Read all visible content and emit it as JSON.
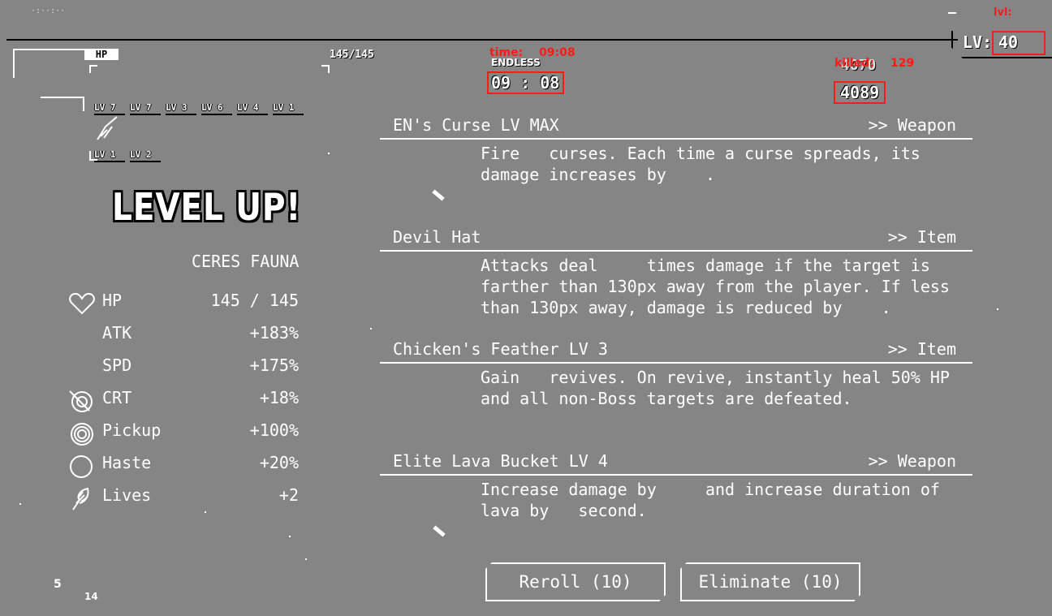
{
  "hud": {
    "hp_label": "HP",
    "hp_count": "145/145",
    "timer_mode": "ENDLESS",
    "timer": "09 : 08",
    "kill_count": "4089",
    "kill_count_prev": "4070",
    "level_label": "LV:",
    "level_value": "40",
    "corner_text": "·:··:··",
    "bottom_left_a": "5",
    "bottom_left_b": "14"
  },
  "debug": {
    "lvl_tag": "lvl:",
    "time_tag": "time:",
    "time_value": "09:08",
    "killed_tag": "killed:",
    "killed_value": "129"
  },
  "weapon_levels": [
    "LV 7",
    "LV 7",
    "LV 3",
    "LV 6",
    "LV 4",
    "LV 1"
  ],
  "item_levels": [
    "LV 1",
    "LV 2"
  ],
  "level_up": {
    "title": "LEVEL UP!",
    "character": "CERES FAUNA"
  },
  "stats": [
    {
      "icon": "heart-icon",
      "label": "HP",
      "value": "145 / 145"
    },
    {
      "icon": "",
      "label": "ATK",
      "value": "+183%"
    },
    {
      "icon": "",
      "label": "SPD",
      "value": "+175%"
    },
    {
      "icon": "crit-target-icon",
      "label": "CRT",
      "value": "+18%"
    },
    {
      "icon": "pickup-rings-icon",
      "label": "Pickup",
      "value": "+100%"
    },
    {
      "icon": "haste-circle-icon",
      "label": "Haste",
      "value": "+20%"
    },
    {
      "icon": "feather-icon",
      "label": "Lives",
      "value": "+2"
    }
  ],
  "upgrades": [
    {
      "title": "EN's Curse LV MAX",
      "type": ">> Weapon",
      "desc": "Fire   curses. Each time a curse spreads, its\ndamage increases by    ."
    },
    {
      "title": "Devil Hat",
      "type": ">> Item",
      "desc": "Attacks deal     times damage if the target is\nfarther than 130px away from the player. If less\nthan 130px away, damage is reduced by    ."
    },
    {
      "title": "Chicken's Feather LV 3",
      "type": ">> Item",
      "desc": "Gain   revives. On revive, instantly heal 50% HP\nand all non-Boss targets are defeated."
    },
    {
      "title": "Elite Lava Bucket LV 4",
      "type": ">> Weapon",
      "desc": "Increase damage by     and increase duration of\nlava by   second."
    }
  ],
  "buttons": {
    "reroll": "Reroll (10)",
    "eliminate": "Eliminate (10)"
  },
  "colors": {
    "background": "#858585",
    "text": "#ffffff",
    "debug": "#ff1a1a"
  }
}
